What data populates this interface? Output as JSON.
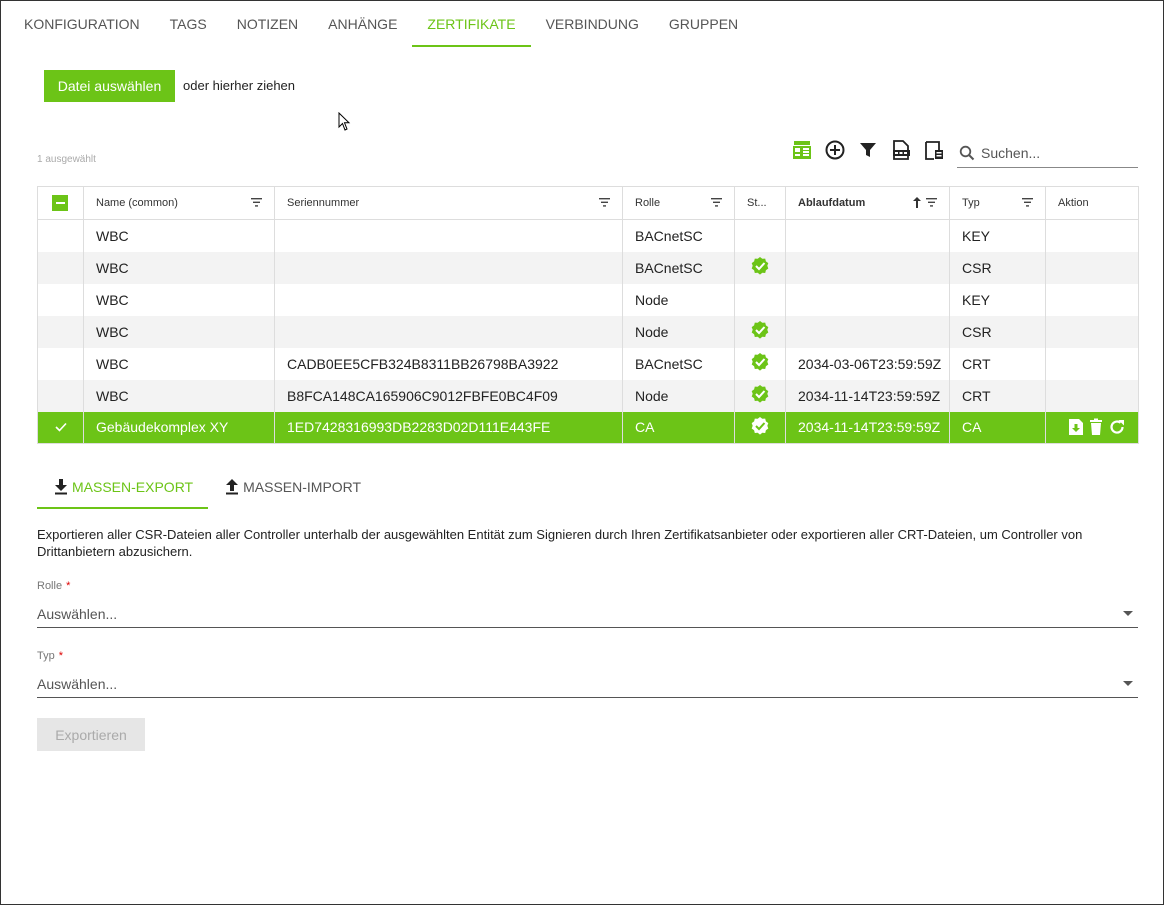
{
  "tabs": [
    "KONFIGURATION",
    "TAGS",
    "NOTIZEN",
    "ANHÄNGE",
    "ZERTIFIKATE",
    "VERBINDUNG",
    "GRUPPEN"
  ],
  "active_tab": 4,
  "upload": {
    "button_label": "Datei auswählen",
    "hint": "oder hierher ziehen"
  },
  "selection_info": "1 ausgewählt",
  "toolbar": {
    "icons": [
      "ledger-icon",
      "add-circle-icon",
      "filter-icon",
      "csv-export-icon",
      "column-settings-icon"
    ]
  },
  "search": {
    "placeholder": "Suchen..."
  },
  "table": {
    "columns": [
      "Name (common)",
      "Seriennummer",
      "Rolle",
      "St...",
      "Ablaufdatum",
      "Typ",
      "Aktion"
    ],
    "sort": {
      "column": "Ablaufdatum",
      "direction": "ascending"
    },
    "rows": [
      {
        "name": "WBC",
        "serial": "",
        "role": "BACnetSC",
        "status": "",
        "expiry": "",
        "type": "KEY"
      },
      {
        "name": "WBC",
        "serial": "",
        "role": "BACnetSC",
        "status": "valid",
        "expiry": "",
        "type": "CSR"
      },
      {
        "name": "WBC",
        "serial": "",
        "role": "Node",
        "status": "",
        "expiry": "",
        "type": "KEY"
      },
      {
        "name": "WBC",
        "serial": "",
        "role": "Node",
        "status": "valid",
        "expiry": "",
        "type": "CSR"
      },
      {
        "name": "WBC",
        "serial": "CADB0EE5CFB324B8311BB26798BA3922",
        "role": "BACnetSC",
        "status": "valid",
        "expiry": "2034-03-06T23:59:59Z",
        "type": "CRT"
      },
      {
        "name": "WBC",
        "serial": "B8FCA148CA165906C9012FBFE0BC4F09",
        "role": "Node",
        "status": "valid",
        "expiry": "2034-11-14T23:59:59Z",
        "type": "CRT"
      },
      {
        "name": "Gebäudekomplex XY",
        "serial": "1ED7428316993DB2283D02D111E443FE",
        "role": "CA",
        "status": "valid",
        "expiry": "2034-11-14T23:59:59Z",
        "type": "CA",
        "selected": true
      }
    ]
  },
  "mass_tabs": [
    "MASSEN-EXPORT",
    "MASSEN-IMPORT"
  ],
  "export": {
    "description": "Exportieren aller CSR-Dateien aller Controller unterhalb der ausgewählten Entität zum Signieren durch Ihren Zertifikatsanbieter oder exportieren aller CRT-Dateien, um Controller von Drittanbietern abzusichern.",
    "role_label": "Rolle",
    "role_value": "Auswählen...",
    "type_label": "Typ",
    "type_value": "Auswählen...",
    "required_mark": "*",
    "button_label": "Exportieren"
  },
  "colors": {
    "accent": "#6cc417",
    "stripe": "#f3f3f3",
    "disabled": "#e6e6e6"
  }
}
